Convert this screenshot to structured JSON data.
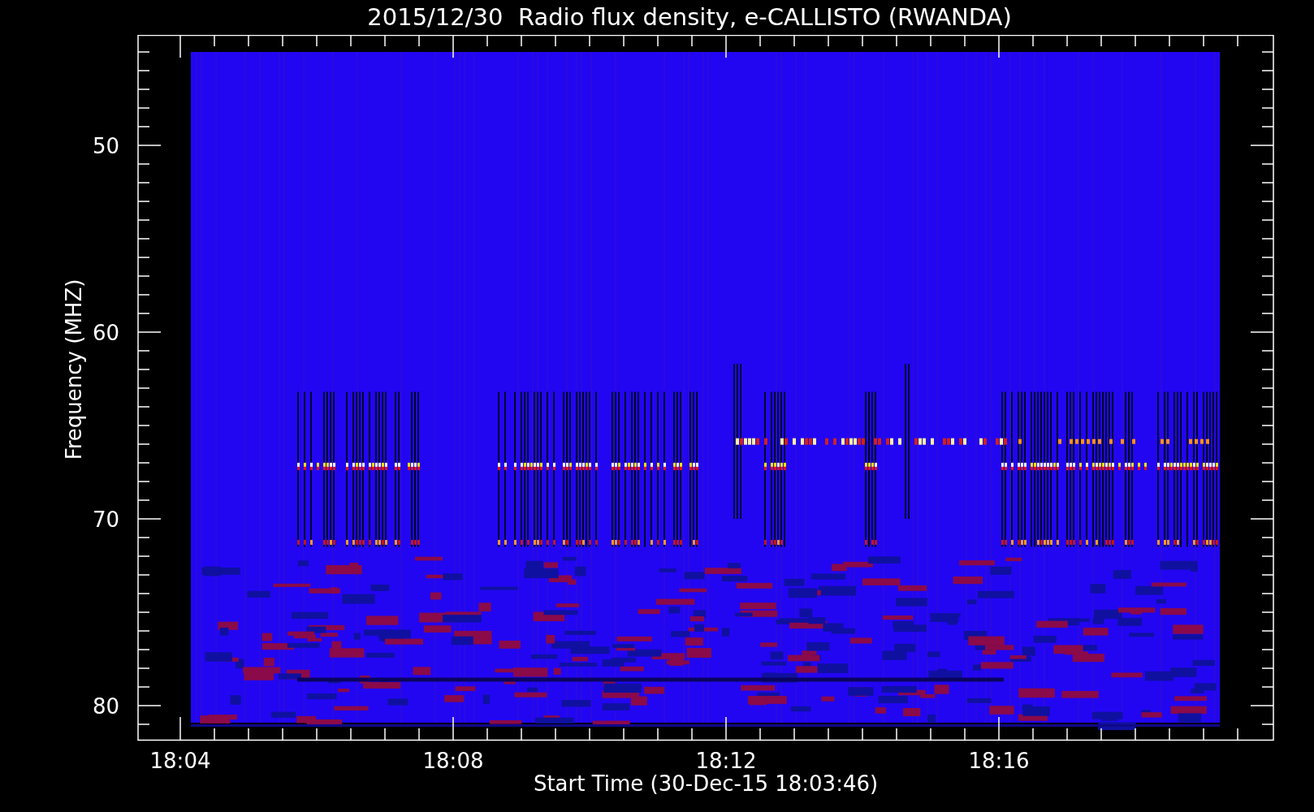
{
  "title": "2015/12/30  Radio flux density, e-CALLISTO (RWANDA)",
  "y_axis": {
    "label": "Frequency (MHZ)",
    "ticks": [
      "50",
      "60",
      "70",
      "80"
    ]
  },
  "x_axis": {
    "label": "Start Time (30-Dec-15 18:03:46)",
    "ticks": [
      "18:04",
      "18:08",
      "18:12",
      "18:16"
    ]
  }
}
